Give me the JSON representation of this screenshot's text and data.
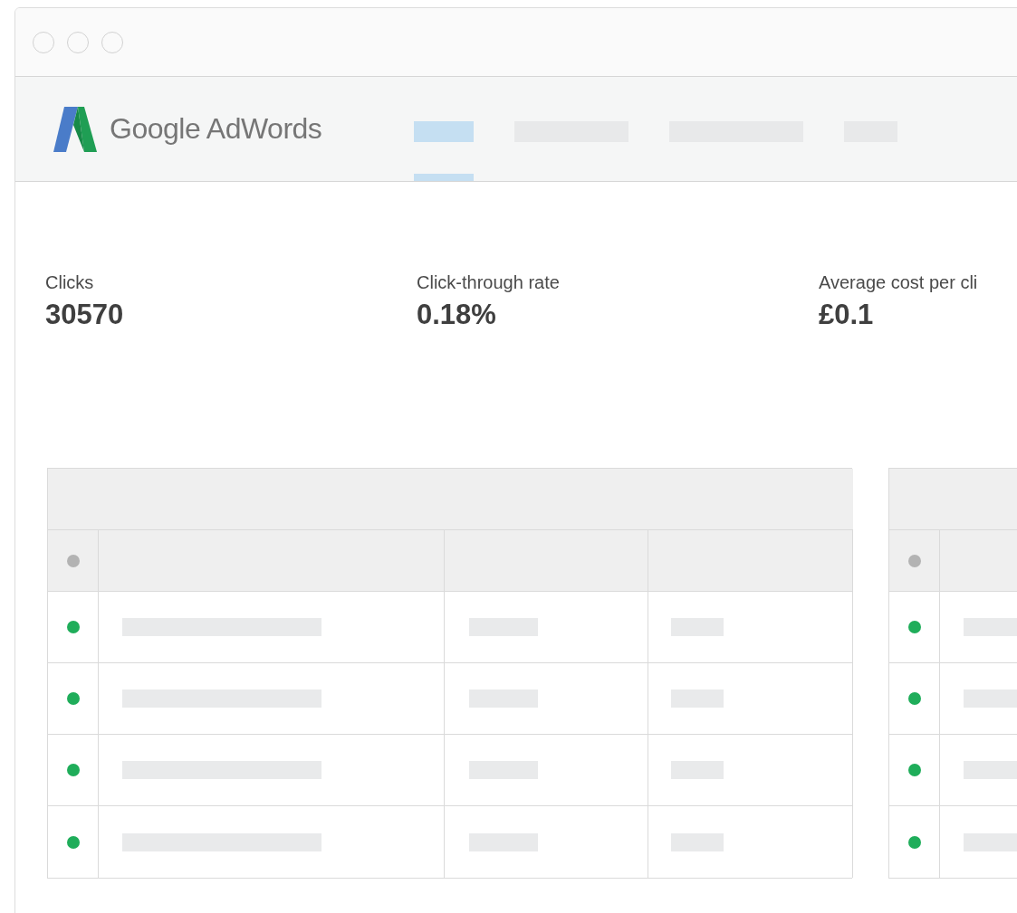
{
  "brand": {
    "name": "Google AdWords"
  },
  "nav": [
    {
      "selected": true
    },
    {
      "selected": false
    },
    {
      "selected": false
    },
    {
      "selected": false
    }
  ],
  "metrics": [
    {
      "label": "Clicks",
      "value": "30570"
    },
    {
      "label": "Click-through rate",
      "value": "0.18%"
    },
    {
      "label": "Average cost per cli",
      "value": "£0.1"
    }
  ],
  "tables": [
    {
      "header_dot": {
        "color": "#b3b3b3"
      },
      "rows": [
        {
          "color": "#1fad5a"
        },
        {
          "color": "#1fad5a"
        },
        {
          "color": "#1fad5a"
        },
        {
          "color": "#1fad5a"
        }
      ]
    },
    {
      "header_dot": {
        "color": "#b3b3b3"
      },
      "rows": [
        {
          "color": "#1fad5a"
        },
        {
          "color": "#1fad5a"
        },
        {
          "color": "#1fad5a"
        },
        {
          "color": "#1fad5a"
        }
      ]
    }
  ]
}
